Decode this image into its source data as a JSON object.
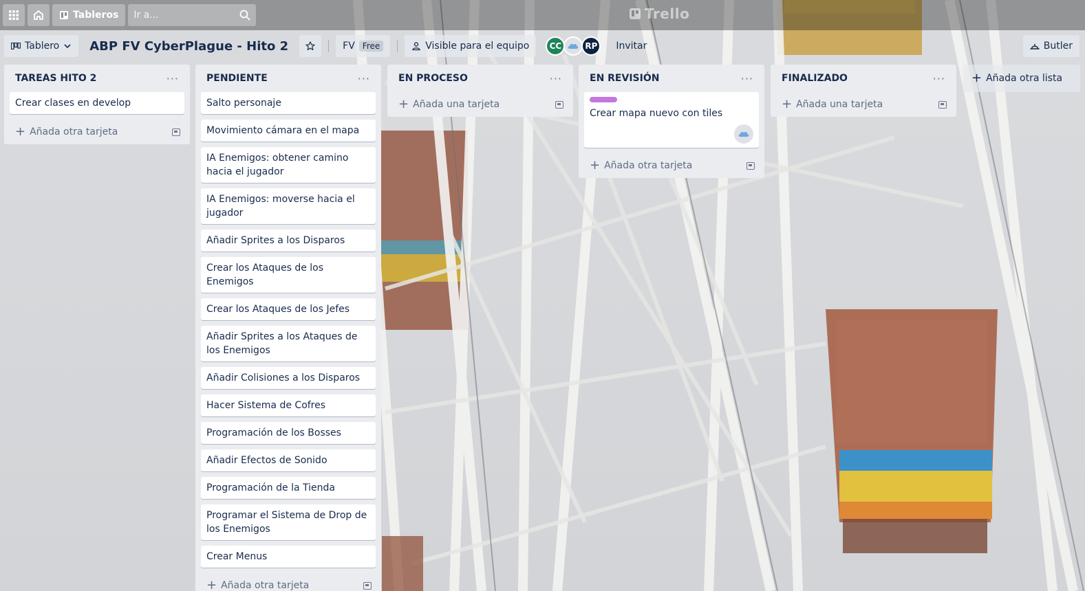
{
  "topbar": {
    "boards_label": "Tableros",
    "search_placeholder": "Ir a...",
    "logo_text": "Trello"
  },
  "board": {
    "view_label": "Tablero",
    "title": "ABP FV CyberPlague - Hito 2",
    "workspace_abbr": "FV",
    "plan_badge": "Free",
    "visibility_label": "Visible para el equipo",
    "members": [
      "CC",
      "",
      "RP"
    ],
    "invite_label": "Invitar",
    "butler_label": "Butler"
  },
  "lists": [
    {
      "title": "TAREAS HITO 2",
      "cards": [
        "Crear clases en develop"
      ],
      "add_label": "Añada otra tarjeta"
    },
    {
      "title": "PENDIENTE",
      "cards": [
        "Salto personaje",
        "Movimiento cámara en el mapa",
        "IA Enemigos: obtener camino hacia el jugador",
        "IA Enemigos: moverse hacia el jugador",
        "Añadir Sprites a los Disparos",
        "Crear los Ataques de los Enemigos",
        "Crear los Ataques de los Jefes",
        "Añadir Sprites a los Ataques de los Enemigos",
        "Añadir Colisiones a los Disparos",
        "Hacer Sistema de Cofres",
        "Programación de los Bosses",
        "Añadir Efectos de Sonido",
        "Programación de la Tienda",
        "Programar el Sistema de Drop de los Enemigos",
        "Crear Menus"
      ],
      "add_label": "Añada otra tarjeta"
    },
    {
      "title": "EN PROCESO",
      "cards": [],
      "add_label": "Añada una tarjeta"
    },
    {
      "title": "EN REVISIÓN",
      "cards": [
        "Crear mapa nuevo con tiles"
      ],
      "add_label": "Añada otra tarjeta"
    },
    {
      "title": "FINALIZADO",
      "cards": [],
      "add_label": "Añada una tarjeta"
    }
  ],
  "add_list_label": "Añada otra lista",
  "colors": {
    "label_purple": "#c377e0",
    "member_cc": "#1f845a",
    "member_rp": "#0c2340",
    "list_bg": "#ebecf0"
  }
}
